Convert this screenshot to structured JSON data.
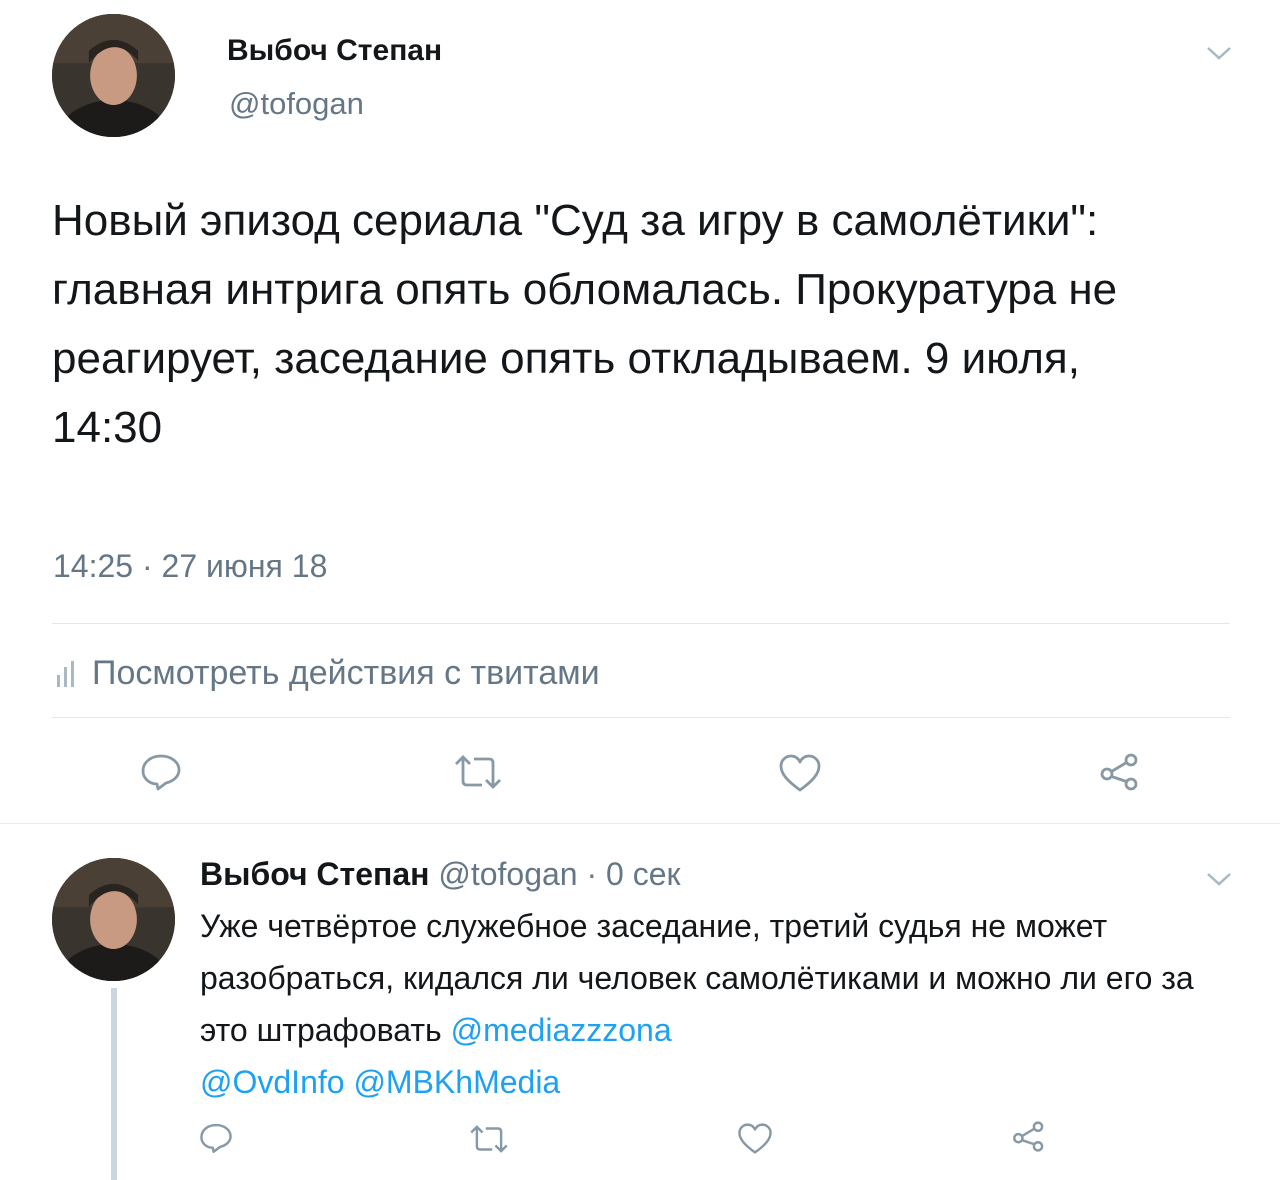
{
  "main_tweet": {
    "author": {
      "name": "Выбоч Степан",
      "handle": "@tofogan"
    },
    "text": "Новый эпизод сериала \"Суд за игру в самолётики\": главная интрига опять обломалась. Прокуратура не реагирует, заседание опять откладываем. 9 июля, 14:30",
    "timestamp": "14:25 · 27 июня 18",
    "activity_label": "Посмотреть действия с твитами"
  },
  "reply": {
    "author": {
      "name": "Выбоч Степан",
      "handle": "@tofogan",
      "sep": " · ",
      "age": "0 сек"
    },
    "text": "Уже четвёртое служебное заседание, третий судья не может разобраться, кидался ли человек самолётиками и можно ли его за это штрафовать ",
    "mentions": [
      "@mediazzzona",
      "@OvdInfo",
      "@MBKhMedia"
    ]
  },
  "icons": {
    "reply": "reply-icon",
    "retweet": "retweet-icon",
    "like": "heart-icon",
    "share": "share-icon",
    "more": "chevron-down-icon",
    "analytics": "bar-chart-icon"
  },
  "colors": {
    "link": "#1da1f2",
    "muted": "#657786",
    "text": "#14171a",
    "divider": "#e1e8ed",
    "thread_line": "#ccd6dd"
  }
}
